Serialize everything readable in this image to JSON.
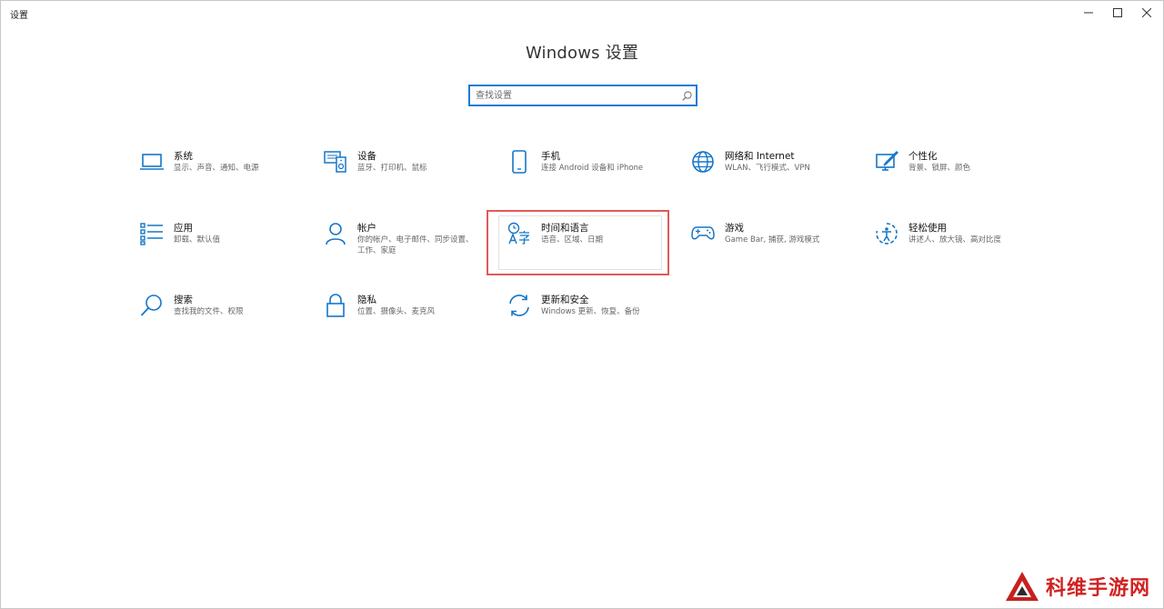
{
  "window": {
    "title": "设置"
  },
  "page_title": "Windows 设置",
  "search": {
    "placeholder": "查找设置",
    "value": ""
  },
  "tiles": [
    {
      "label": "系统",
      "desc": "显示、声音、通知、电源",
      "icon": "laptop-icon"
    },
    {
      "label": "设备",
      "desc": "蓝牙、打印机、鼠标",
      "icon": "devices-icon"
    },
    {
      "label": "手机",
      "desc": "连接 Android 设备和 iPhone",
      "icon": "phone-icon"
    },
    {
      "label": "网络和 Internet",
      "desc": "WLAN、飞行模式、VPN",
      "icon": "globe-icon"
    },
    {
      "label": "个性化",
      "desc": "背景、锁屏、颜色",
      "icon": "personalization-icon"
    },
    {
      "label": "应用",
      "desc": "卸载、默认值",
      "icon": "apps-list-icon"
    },
    {
      "label": "帐户",
      "desc": "你的帐户、电子邮件、同步设置、工作、家庭",
      "icon": "person-icon"
    },
    {
      "label": "时间和语言",
      "desc": "语音、区域、日期",
      "icon": "time-language-icon"
    },
    {
      "label": "游戏",
      "desc": "Game Bar, 捕获, 游戏模式",
      "icon": "gamepad-icon"
    },
    {
      "label": "轻松使用",
      "desc": "讲述人、放大镜、高对比度",
      "icon": "ease-of-access-icon"
    },
    {
      "label": "搜索",
      "desc": "查找我的文件、权限",
      "icon": "search-icon"
    },
    {
      "label": "隐私",
      "desc": "位置、摄像头、麦克风",
      "icon": "lock-icon"
    },
    {
      "label": "更新和安全",
      "desc": "Windows 更新、恢复、备份",
      "icon": "sync-icon"
    }
  ],
  "watermark": {
    "text": "科维手游网"
  },
  "colors": {
    "accent": "#1576c8",
    "highlight": "#e05a5a",
    "watermark": "#d12222"
  }
}
